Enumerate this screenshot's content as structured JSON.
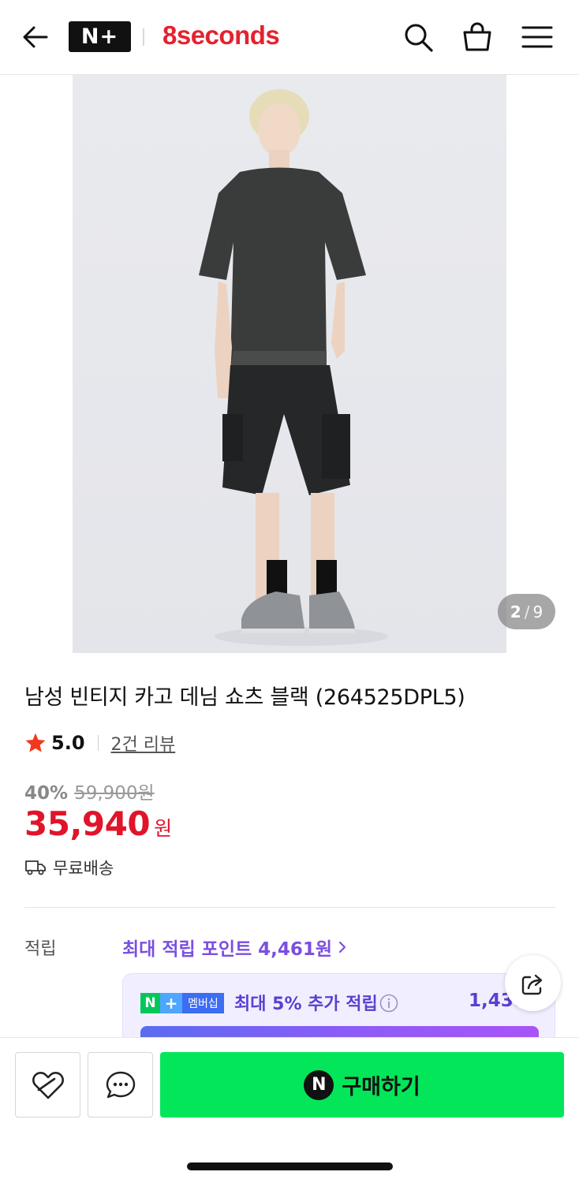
{
  "header": {
    "logo_text": "N+",
    "brand_name": "8seconds"
  },
  "gallery": {
    "current": "2",
    "total": "9"
  },
  "product": {
    "title": "남성 빈티지 카고 데님 쇼츠 블랙 (264525DPL5)",
    "rating": "5.0",
    "review_link": "2건 리뷰",
    "discount_rate": "40%",
    "original_price": "59,900원",
    "price": "35,940",
    "currency": "원",
    "shipping": "무료배송"
  },
  "points": {
    "label": "적립",
    "max_points": "최대 적립 포인트 4,461원",
    "membership_badge_n": "N",
    "membership_badge_plus": "+",
    "membership_badge_text": "멤버십",
    "membership_text": "최대 5% 추가 적립",
    "membership_points": "1,437"
  },
  "actions": {
    "buy_icon": "N",
    "buy_label": "구매하기"
  },
  "colors": {
    "brand": "#e4222e",
    "price": "#e0142a",
    "buy_button": "#03e65a",
    "points_purple": "#7a4fe0"
  },
  "icons": [
    "back-arrow-icon",
    "search-icon",
    "shopping-bag-icon",
    "menu-icon",
    "star-icon",
    "truck-icon",
    "chevron-right-icon",
    "info-icon",
    "share-icon",
    "heart-icon",
    "chat-icon"
  ]
}
